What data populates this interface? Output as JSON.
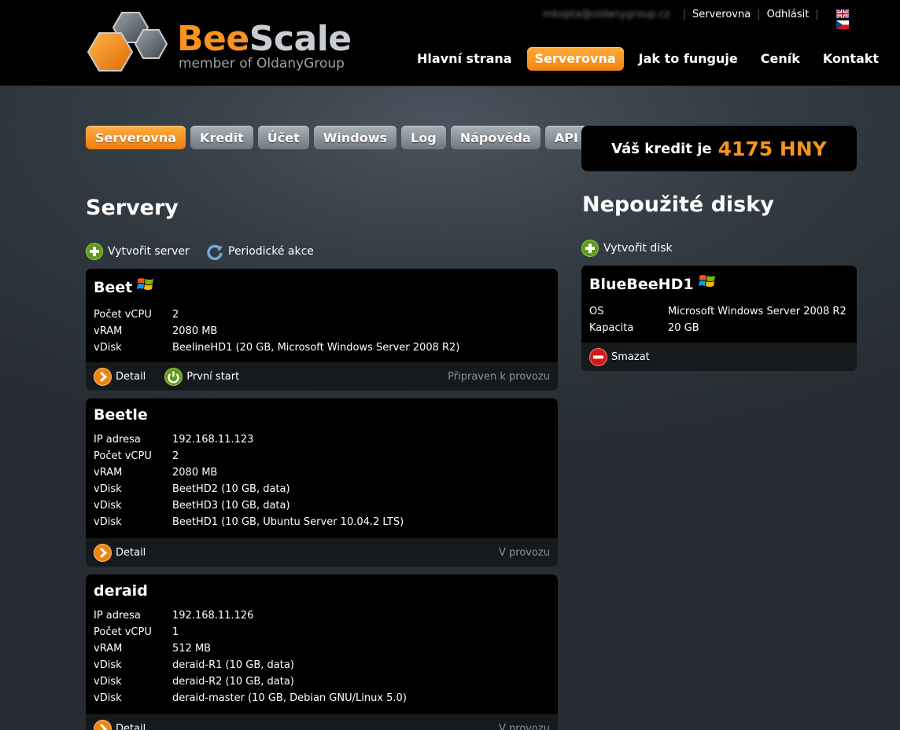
{
  "header": {
    "logo_bee": "Bee",
    "logo_scale": "Scale",
    "logo_sub": "member of OldanyGroup",
    "user_email": "mkopta@oldanygroup.cz",
    "top_links": [
      "Serverovna",
      "Odhlásit"
    ],
    "flags": [
      "gb-flag",
      "cz-flag"
    ],
    "nav": [
      "Hlavní strana",
      "Serverovna",
      "Jak to funguje",
      "Ceník",
      "Kontakt"
    ],
    "nav_active": "Serverovna"
  },
  "tabs": [
    "Serverovna",
    "Kredit",
    "Účet",
    "Windows",
    "Log",
    "Nápověda",
    "API"
  ],
  "tabs_active": "Serverovna",
  "credit": {
    "label": "Váš kredit je",
    "amount": "4175 HNY"
  },
  "servers": {
    "heading": "Servery",
    "create_label": "Vytvořit server",
    "periodic_label": "Periodické akce",
    "items": [
      {
        "name": "Beet",
        "os_icon": "windows-icon",
        "rows": [
          {
            "k": "Počet vCPU",
            "v": "2"
          },
          {
            "k": "vRAM",
            "v": "2080 MB"
          },
          {
            "k": "vDisk",
            "v": "BeelineHD1 (20 GB, Microsoft Windows Server 2008 R2)"
          }
        ],
        "detail": "Detail",
        "first_start": "První start",
        "status": "Připraven k provozu"
      },
      {
        "name": "Beetle",
        "rows": [
          {
            "k": "IP adresa",
            "v": "192.168.11.123"
          },
          {
            "k": "Počet vCPU",
            "v": "2"
          },
          {
            "k": "vRAM",
            "v": "2080 MB"
          },
          {
            "k": "vDisk",
            "v": "BeetHD2 (10 GB, data)"
          },
          {
            "k": "vDisk",
            "v": "BeetHD3 (10 GB, data)"
          },
          {
            "k": "vDisk",
            "v": "BeetHD1 (10 GB, Ubuntu Server 10.04.2 LTS)"
          }
        ],
        "detail": "Detail",
        "status": "V provozu"
      },
      {
        "name": "deraid",
        "rows": [
          {
            "k": "IP adresa",
            "v": "192.168.11.126"
          },
          {
            "k": "Počet vCPU",
            "v": "1"
          },
          {
            "k": "vRAM",
            "v": "512 MB"
          },
          {
            "k": "vDisk",
            "v": "deraid-R1 (10 GB, data)"
          },
          {
            "k": "vDisk",
            "v": "deraid-R2 (10 GB, data)"
          },
          {
            "k": "vDisk",
            "v": "deraid-master (10 GB, Debian GNU/Linux 5.0)"
          }
        ],
        "detail": "Detail",
        "status": "V provozu"
      }
    ]
  },
  "disks": {
    "heading": "Nepoužité disky",
    "create_label": "Vytvořit disk",
    "items": [
      {
        "name": "BlueBeeHD1",
        "os_icon": "windows-icon",
        "rows": [
          {
            "k": "OS",
            "v": "Microsoft Windows Server 2008 R2"
          },
          {
            "k": "Kapacita",
            "v": "20 GB"
          }
        ],
        "delete": "Smazat"
      }
    ]
  },
  "colors": {
    "accent": "#f7931e",
    "background": "#2a3037",
    "card": "#000000",
    "card_footer": "#171a1d",
    "status_text": "#8c9196"
  }
}
